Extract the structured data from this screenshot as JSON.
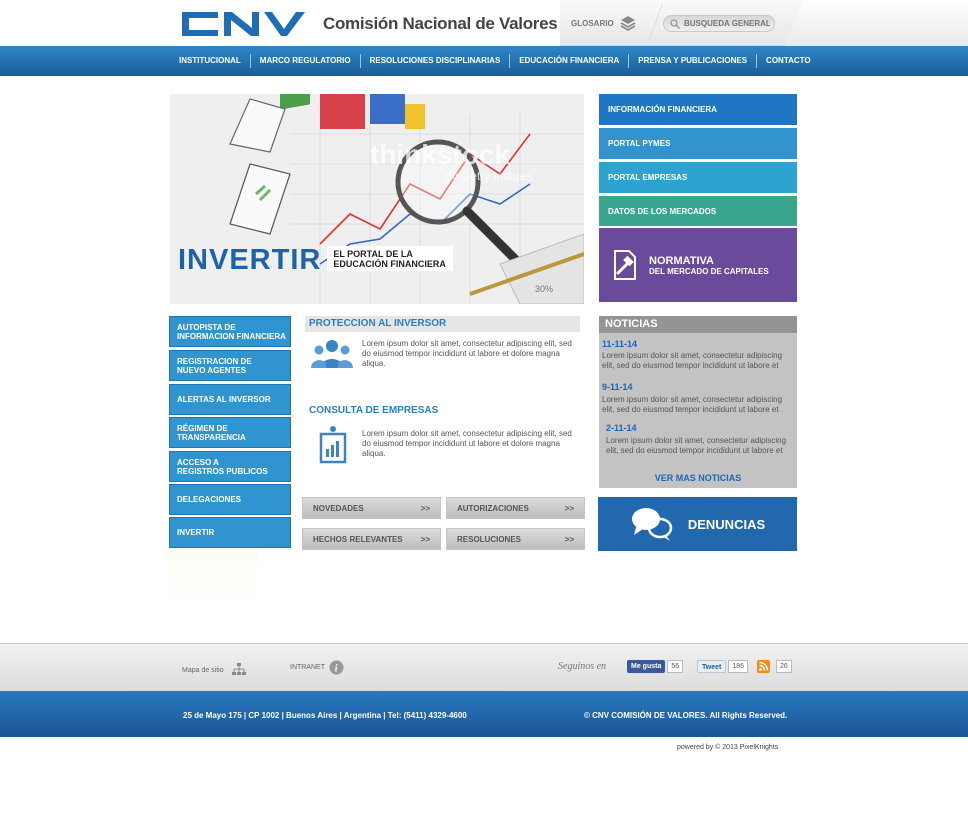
{
  "header": {
    "logo_text": "CNV",
    "title": "Comisión Nacional de Valores",
    "glosario_label": "GLOSARIO",
    "search_placeholder": "BUSQUEDA GENERAL"
  },
  "nav": {
    "items": [
      "INSTITUCIONAL",
      "MARCO REGULATORIO",
      "RESOLUCIONES DISCIPLINARIAS",
      "EDUCACIÓN FINANCIERA",
      "PRENSA Y PUBLICACIONES",
      "CONTACTO"
    ]
  },
  "hero": {
    "title": "INVERTIR",
    "subtitle_line1": "EL PORTAL DE LA",
    "subtitle_line2": "EDUCACIÓN FINANCIERA"
  },
  "promos": [
    {
      "label": "INFORMACIÓN FINANCIERA",
      "color": "#1e76c4"
    },
    {
      "label": "PORTAL PYMES",
      "color": "#3393cf"
    },
    {
      "label": "PORTAL EMPRESAS",
      "color": "#2fa3cf"
    },
    {
      "label": "DATOS DE LOS MERCADOS",
      "color": "#3aa68f"
    }
  ],
  "normativa": {
    "title": "NORMATIVA",
    "subtitle": "DEL MERCADO DE CAPITALES"
  },
  "sidebar": {
    "items": [
      [
        "AUTOPISTA DE",
        "INFORMACION FINANCIERA"
      ],
      [
        "REGISTRACION DE",
        "NUEVO AGENTES"
      ],
      [
        "ALERTAS AL INVERSOR",
        ""
      ],
      [
        "RÉGIMEN DE",
        "TRANSPARENCIA"
      ],
      [
        "ACCESO A",
        "REGISTROS PUBLICOS"
      ],
      [
        "DELEGACIONES",
        ""
      ],
      [
        "INVERTIR",
        ""
      ]
    ]
  },
  "sections": {
    "proteccion": {
      "title": "PROTECCION AL INVERSOR",
      "text": "Lorem ipsum dolor sit amet, consectetur adipiscing elit, sed do eiusmod tempor incididunt ut labore et dolore magna aliqua."
    },
    "consulta": {
      "title": "CONSULTA DE EMPRESAS",
      "text": "Lorem ipsum dolor sit amet, consectetur adipiscing elit, sed do eiusmod tempor incididunt ut labore et dolore magna aliqua."
    }
  },
  "quicklinks": {
    "novedades": "NOVEDADES",
    "autorizaciones": "AUTORIZACIONES",
    "hechos": "HECHOS RELEVANTES",
    "resoluciones": "RESOLUCIONES",
    "arrow": ">>"
  },
  "noticias": {
    "title": "NOTICIAS",
    "items": [
      {
        "date": "11-11-14",
        "text": "Lorem ipsum dolor sit amet, consectetur adipiscing elit, sed do eiusmod tempor incididunt ut labore et"
      },
      {
        "date": "9-11-14",
        "text": "Lorem ipsum dolor sit amet, consectetur adipiscing elit, sed do eiusmod tempor incididunt ut labore et"
      },
      {
        "date": "2-11-14",
        "text": "Lorem ipsum dolor sit amet, consectetur adipiscing elit, sed do eiusmod tempor incididunt ut labore et"
      }
    ],
    "ver_mas": "VER MAS NOTICIAS"
  },
  "denuncias": "DENUNCIAS",
  "footer": {
    "mapa": "Mapa de sitio",
    "intranet": "INTRANET",
    "seguinos": "Seguinos en",
    "facebook_label": "Me gusta",
    "facebook_count": "56",
    "tweet_label": "Tweet",
    "tweet_count": "186",
    "rss_count": "26",
    "address": "25 de Mayo 175  |   CP 1002  |   Buenos Aires  |   Argentina  |   Tel: (5411) 4329-4600",
    "copyright": "© CNV COMISIÓN DE VALORES. All Rights Reserved.",
    "powered": "powered by © 2013 PixelKnights"
  }
}
